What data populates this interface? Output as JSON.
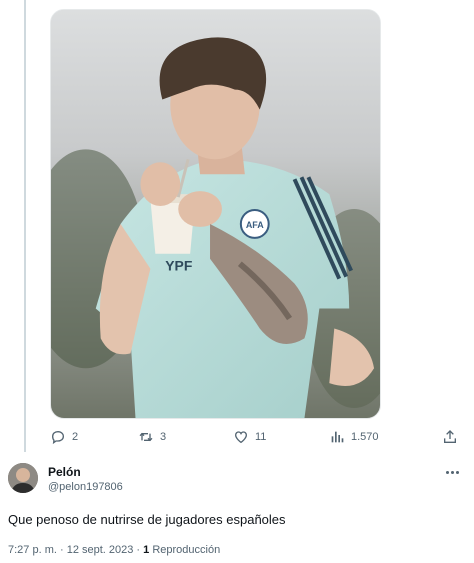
{
  "media": {
    "kind": "photo",
    "subject": "player-drinking-mate",
    "jersey_text": "YPF",
    "jersey_badge": "AFA"
  },
  "actions": {
    "replies": "2",
    "retweets": "3",
    "likes": "11",
    "views": "1.570"
  },
  "reply": {
    "display_name": "Pelón",
    "handle": "@pelon197806",
    "text": "Que penoso de nutrirse de jugadores españoles",
    "time": "7:27 p. m.",
    "separator": " · ",
    "date": "12 sept. 2023",
    "views_count": "1",
    "views_label": " Reproducción"
  },
  "colors": {
    "accent": "#1d9bf0",
    "muted": "#536471",
    "text": "#0f1419",
    "thread_line": "#cfd9de"
  }
}
